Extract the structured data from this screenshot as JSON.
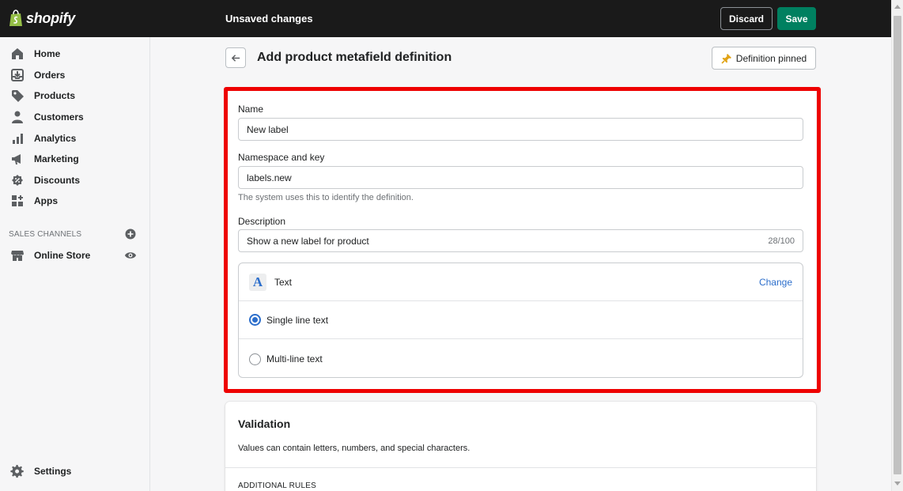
{
  "topbar": {
    "brand": "shopify",
    "status": "Unsaved changes",
    "discard_label": "Discard",
    "save_label": "Save"
  },
  "sidebar": {
    "items": [
      {
        "label": "Home",
        "icon": "home-icon"
      },
      {
        "label": "Orders",
        "icon": "orders-icon"
      },
      {
        "label": "Products",
        "icon": "tag-icon"
      },
      {
        "label": "Customers",
        "icon": "person-icon"
      },
      {
        "label": "Analytics",
        "icon": "bar-chart-icon"
      },
      {
        "label": "Marketing",
        "icon": "megaphone-icon"
      },
      {
        "label": "Discounts",
        "icon": "discount-icon"
      },
      {
        "label": "Apps",
        "icon": "apps-icon"
      }
    ],
    "sales_channels_title": "SALES CHANNELS",
    "online_store_label": "Online Store",
    "settings_label": "Settings"
  },
  "page": {
    "title": "Add product metafield definition",
    "pin_label": "Definition pinned"
  },
  "form": {
    "name_label": "Name",
    "name_value": "New label",
    "key_label": "Namespace and key",
    "key_value": "labels.new",
    "key_help": "The system uses this to identify the definition.",
    "description_label": "Description",
    "description_value": "Show a new label for product",
    "description_counter": "28/100",
    "type_name": "Text",
    "type_change": "Change",
    "options": [
      {
        "label": "Single line text",
        "selected": true
      },
      {
        "label": "Multi-line text",
        "selected": false
      }
    ]
  },
  "validation": {
    "title": "Validation",
    "description": "Values can contain letters, numbers, and special characters.",
    "rules_title": "ADDITIONAL RULES"
  },
  "colors": {
    "accent": "#008060",
    "link": "#2c6ecb",
    "highlight": "#ee0000",
    "topbar": "#1a1a1a"
  }
}
